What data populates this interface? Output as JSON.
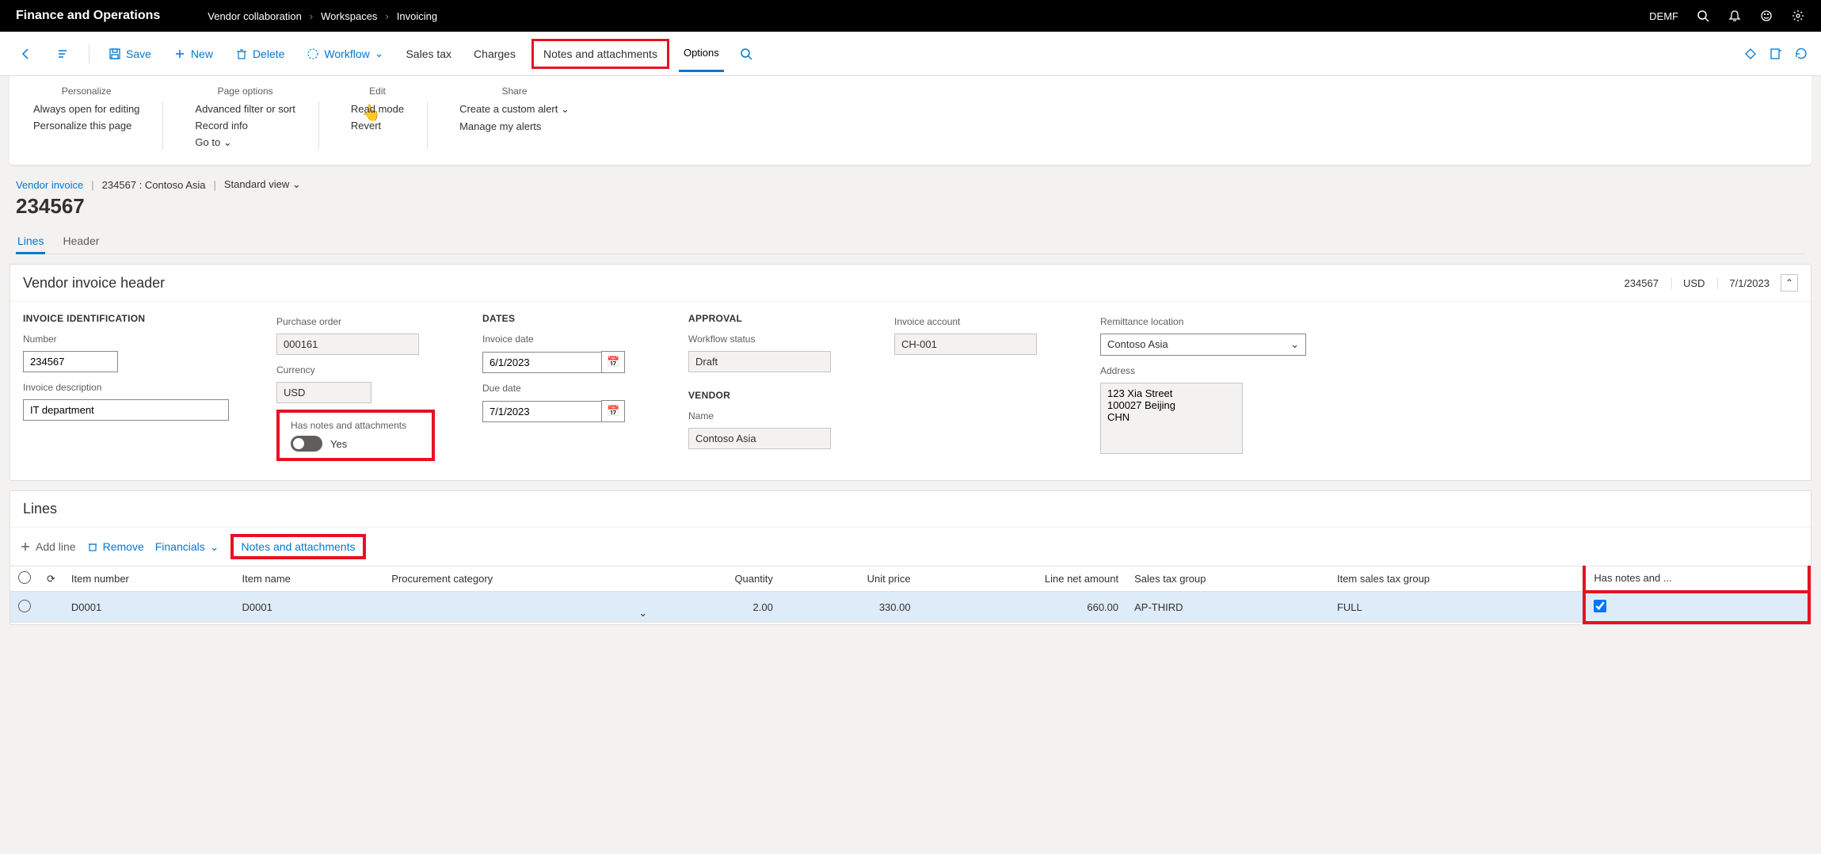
{
  "topbar": {
    "brand": "Finance and Operations",
    "breadcrumb": [
      "Vendor collaboration",
      "Workspaces",
      "Invoicing"
    ],
    "company": "DEMF"
  },
  "toolbar": {
    "save": "Save",
    "new": "New",
    "delete": "Delete",
    "workflow": "Workflow",
    "salestax": "Sales tax",
    "charges": "Charges",
    "notes": "Notes and attachments",
    "options": "Options"
  },
  "ribbon": {
    "personalize": {
      "head": "Personalize",
      "items": [
        "Always open for editing",
        "Personalize this page"
      ]
    },
    "pageoptions": {
      "head": "Page options",
      "items": [
        "Advanced filter or sort",
        "Record info",
        "Go to"
      ]
    },
    "edit": {
      "head": "Edit",
      "items": [
        "Read mode",
        "Revert"
      ]
    },
    "share": {
      "head": "Share",
      "items": [
        "Create a custom alert",
        "Manage my alerts"
      ]
    }
  },
  "page": {
    "crumb_link": "Vendor invoice",
    "crumb_record": "234567 : Contoso Asia",
    "crumb_view": "Standard view",
    "title": "234567",
    "tabs": {
      "lines": "Lines",
      "header": "Header"
    }
  },
  "header_panel": {
    "title": "Vendor invoice header",
    "meta": {
      "number": "234567",
      "currency": "USD",
      "date": "7/1/2023"
    },
    "groups": {
      "ident": {
        "head": "INVOICE IDENTIFICATION",
        "number_label": "Number",
        "number_value": "234567",
        "desc_label": "Invoice description",
        "desc_value": "IT department"
      },
      "po": {
        "po_label": "Purchase order",
        "po_value": "000161",
        "curr_label": "Currency",
        "curr_value": "USD",
        "hasnotes_label": "Has notes and attachments",
        "hasnotes_value": "Yes"
      },
      "dates": {
        "head": "DATES",
        "inv_label": "Invoice date",
        "inv_value": "6/1/2023",
        "due_label": "Due date",
        "due_value": "7/1/2023"
      },
      "approval": {
        "head": "APPROVAL",
        "wf_label": "Workflow status",
        "wf_value": "Draft",
        "vendor_head": "VENDOR",
        "name_label": "Name",
        "name_value": "Contoso Asia"
      },
      "account": {
        "acct_label": "Invoice account",
        "acct_value": "CH-001"
      },
      "remit": {
        "remit_label": "Remittance location",
        "remit_value": "Contoso Asia",
        "addr_label": "Address",
        "addr_value": "123 Xia Street\n100027 Beijing\nCHN"
      }
    }
  },
  "lines_panel": {
    "title": "Lines",
    "bar": {
      "addline": "Add line",
      "remove": "Remove",
      "financials": "Financials",
      "notes": "Notes and attachments"
    },
    "cols": {
      "item": "Item number",
      "name": "Item name",
      "proc": "Procurement category",
      "qty": "Quantity",
      "unit": "Unit price",
      "net": "Line net amount",
      "taxg": "Sales tax group",
      "itemtax": "Item sales tax group",
      "hasnotes": "Has notes and ..."
    },
    "rows": [
      {
        "item": "D0001",
        "name": "D0001",
        "proc": "",
        "qty": "2.00",
        "unit": "330.00",
        "net": "660.00",
        "taxg": "AP-THIRD",
        "itemtax": "FULL",
        "hasnotes": true
      }
    ]
  }
}
